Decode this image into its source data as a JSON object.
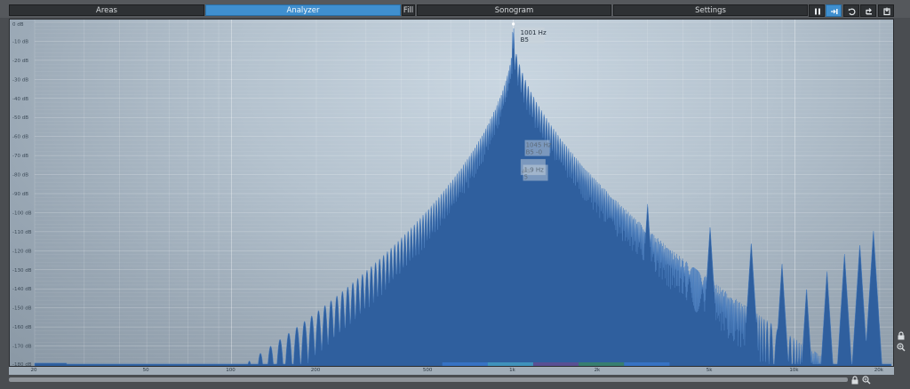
{
  "toolbar": {
    "tabs": [
      {
        "label": "Areas",
        "active": false
      },
      {
        "label": "Analyzer",
        "active": true
      },
      {
        "label": "Fill",
        "active": false
      },
      {
        "label": "Sonogram",
        "active": false
      },
      {
        "label": "Settings",
        "active": false
      }
    ],
    "icons": [
      "pause-icon",
      "freeze-icon",
      "undo-icon",
      "share-icon",
      "export-icon"
    ]
  },
  "chart_data": {
    "type": "area",
    "y_ticks": [
      "0 dB",
      "-10 dB",
      "-20 dB",
      "-30 dB",
      "-40 dB",
      "-50 dB",
      "-60 dB",
      "-70 dB",
      "-80 dB",
      "-90 dB",
      "-100 dB",
      "-110 dB",
      "-120 dB",
      "-130 dB",
      "-140 dB",
      "-150 dB",
      "-160 dB",
      "-170 dB",
      "-180 dB"
    ],
    "x_ticks": [
      "20",
      "50",
      "100",
      "200",
      "500",
      "1k",
      "2k",
      "5k",
      "10k",
      "20k"
    ],
    "x_tick_values": [
      20,
      50,
      100,
      200,
      500,
      1000,
      2000,
      5000,
      10000,
      20000
    ],
    "xlim": [
      20,
      22000
    ],
    "ylim": [
      -180,
      0
    ],
    "x_scale": "log",
    "fill_color": "#2f5f9e",
    "peak_labels": [
      {
        "freq": "1001 Hz",
        "note": "B5",
        "hz": 1001,
        "db": 0
      },
      {
        "freq": "1045 Hz",
        "note": "B5 -0",
        "hz": 1045,
        "db": -60
      },
      {
        "freq": "",
        "note": "#5",
        "hz": 1010,
        "db": -70
      },
      {
        "freq": "1.9 Hz",
        "note": "5",
        "hz": 1030,
        "db": -73
      }
    ],
    "harmonics": [
      {
        "hz": 3000,
        "db": -95
      },
      {
        "hz": 5000,
        "db": -107
      },
      {
        "hz": 7000,
        "db": -115
      },
      {
        "hz": 9000,
        "db": -126
      },
      {
        "hz": 11000,
        "db": -139
      },
      {
        "hz": 13000,
        "db": -130
      },
      {
        "hz": 15000,
        "db": -121
      },
      {
        "hz": 17000,
        "db": -116
      },
      {
        "hz": 19000,
        "db": -109
      }
    ],
    "fundamental_hz": 1001,
    "noise_floor_db": -180
  }
}
